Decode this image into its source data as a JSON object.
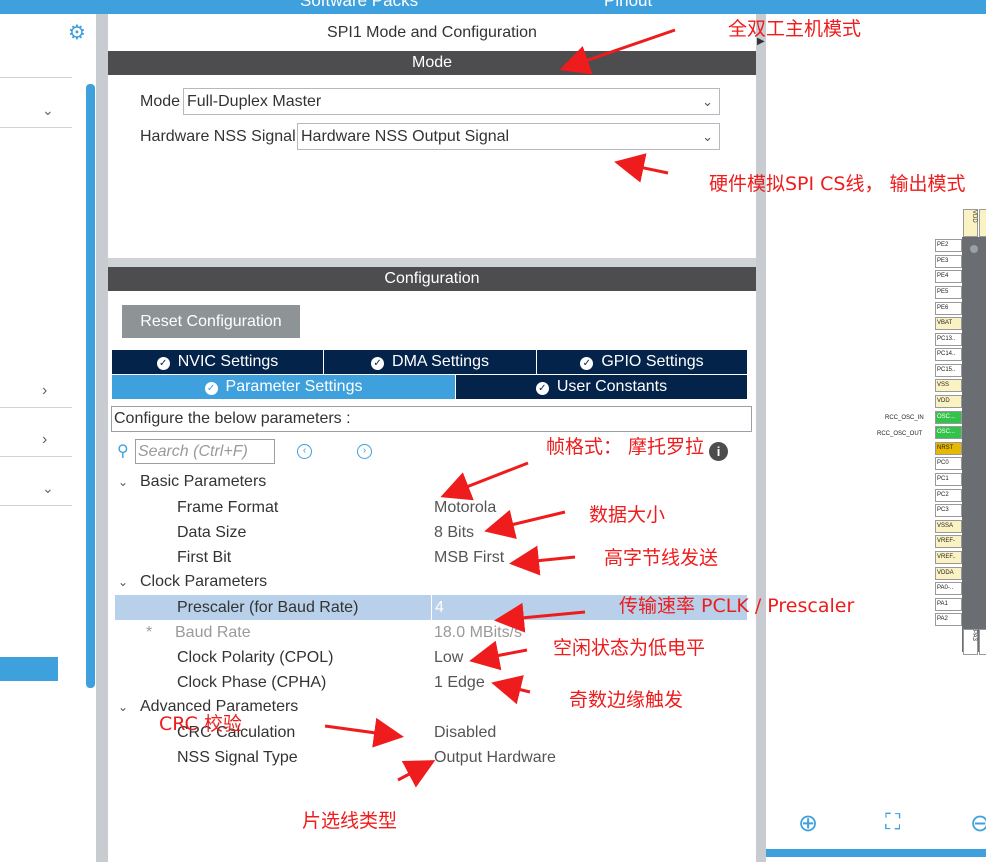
{
  "topbar": {
    "left_label": "Software Packs",
    "right_label": "Pinout"
  },
  "sidebar": {
    "gear_icon": "gear-icon"
  },
  "panel": {
    "title": "SPI1 Mode and Configuration",
    "mode_header": "Mode",
    "mode_label": "Mode",
    "mode_value": "Full-Duplex Master",
    "nss_label": "Hardware NSS Signal",
    "nss_value": "Hardware NSS Output Signal",
    "config_header": "Configuration",
    "reset_button": "Reset Configuration",
    "tabs": [
      {
        "label": "NVIC Settings"
      },
      {
        "label": "DMA Settings"
      },
      {
        "label": "GPIO Settings"
      },
      {
        "label": "Parameter Settings"
      },
      {
        "label": "User Constants"
      }
    ],
    "configure_text": "Configure the below parameters :",
    "search_placeholder": "Search (Ctrl+F)",
    "groups": {
      "basic": "Basic Parameters",
      "clock": "Clock Parameters",
      "advanced": "Advanced Parameters"
    },
    "params": [
      {
        "name": "Frame Format",
        "value": "Motorola"
      },
      {
        "name": "Data Size",
        "value": "8 Bits"
      },
      {
        "name": "First Bit",
        "value": "MSB First"
      },
      {
        "name": "Prescaler (for Baud Rate)",
        "value": "4"
      },
      {
        "name": "Baud Rate",
        "value": "18.0 MBits/s"
      },
      {
        "name": "Clock Polarity (CPOL)",
        "value": "Low"
      },
      {
        "name": "Clock Phase (CPHA)",
        "value": "1 Edge"
      },
      {
        "name": "CRC Calculation",
        "value": "Disabled"
      },
      {
        "name": "NSS Signal Type",
        "value": "Output Hardware"
      }
    ],
    "baud_marker": "*"
  },
  "annotations": {
    "a1": "全双工主机模式",
    "a2": "硬件模拟SPI CS线， 输出模式",
    "a3": "帧格式： 摩托罗拉",
    "a4": "数据大小",
    "a5": "高字节线发送",
    "a6": "传输速率 PCLK / Prescaler",
    "a7": "空闲状态为低电平",
    "a8": "奇数边缘触发",
    "a9": "CRC 校验",
    "a10": "片选线类型"
  },
  "chip": {
    "top_pins": [
      "VDD",
      "V"
    ],
    "pins": [
      "PE2",
      "PE3",
      "PE4",
      "PE5",
      "PE6",
      "VBAT",
      "PC13..",
      "PC14..",
      "PC15..",
      "VSS",
      "VDD",
      "OSC...",
      "OSC...",
      "NRST",
      "PC0",
      "PC1",
      "PC2",
      "PC3",
      "VSSA",
      "VREF-",
      "VREF..",
      "VDDA",
      "PA0-..",
      "PA1",
      "PA2"
    ],
    "osc_in": "RCC_OSC_IN",
    "osc_out": "RCC_OSC_OUT",
    "bottom_pins": [
      "PA3",
      "V"
    ]
  },
  "colors": {
    "accent": "#3ea0dc",
    "dark_header": "#4d4d4f",
    "tab_navy": "#03234b",
    "annotation_red": "#ee1c1c"
  }
}
